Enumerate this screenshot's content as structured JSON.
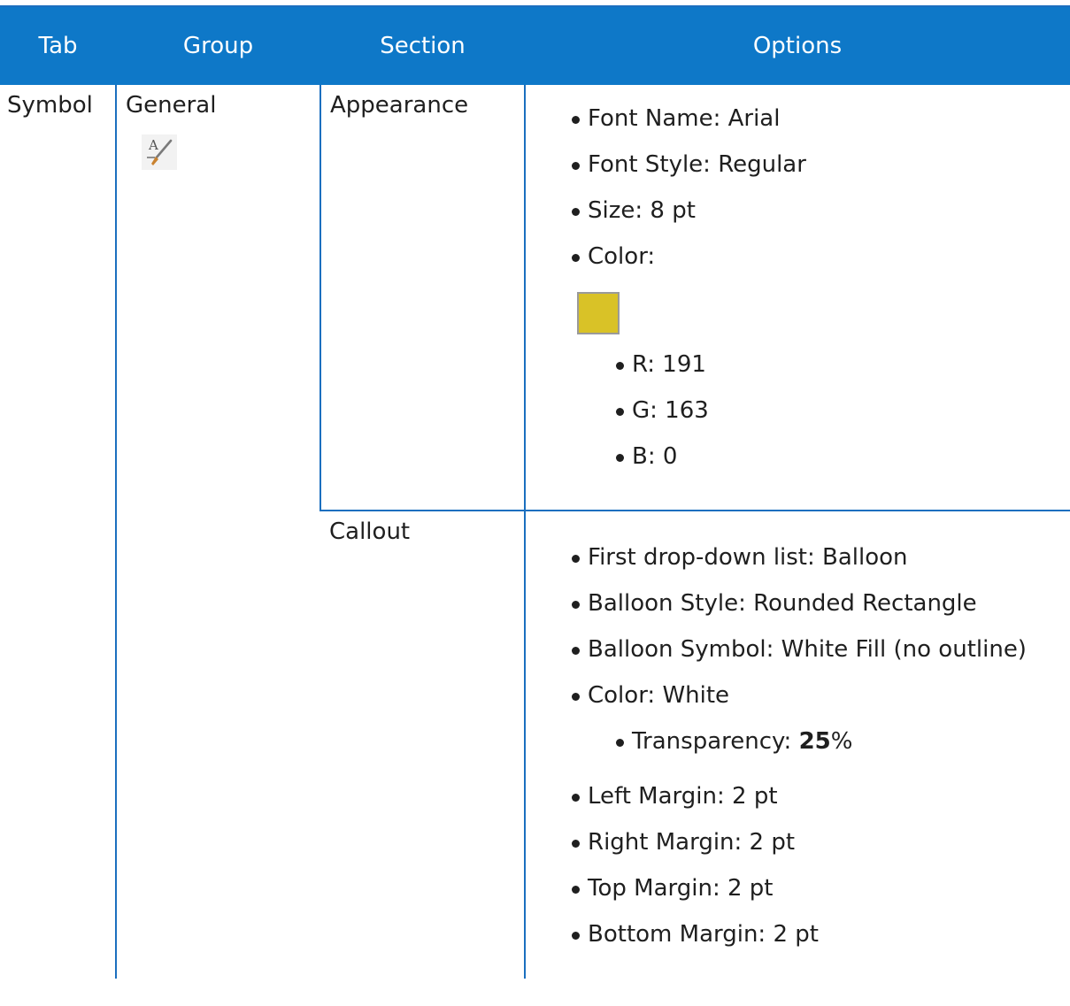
{
  "headers": {
    "tab": "Tab",
    "group": "Group",
    "section": "Section",
    "options": "Options"
  },
  "row": {
    "tab": "Symbol",
    "group": "General",
    "group_icon": "text-symbol-brush-icon"
  },
  "appearance": {
    "section": "Appearance",
    "font_name": "Font Name: Arial",
    "font_style": "Font Style: Regular",
    "size": "Size: 8 pt",
    "color_label": "Color:",
    "swatch_color": "#D9C227",
    "r": "R: 191",
    "g": "G: 163",
    "b": "B: 0"
  },
  "callout": {
    "section": "Callout",
    "dropdown": "First drop-down list: Balloon",
    "balloon_style": "Balloon Style: Rounded Rectangle",
    "balloon_symbol": "Balloon Symbol: White Fill (no outline)",
    "color": "Color: White",
    "transparency_label": "Transparency: ",
    "transparency_value": "25",
    "transparency_unit": "%",
    "left_margin": "Left Margin: 2 pt",
    "right_margin": "Right Margin: 2 pt",
    "top_margin": "Top Margin: 2 pt",
    "bottom_margin": "Bottom Margin: 2 pt"
  },
  "colors": {
    "header_bg": "#0E78C8",
    "grid_line": "#1B6FBF"
  }
}
